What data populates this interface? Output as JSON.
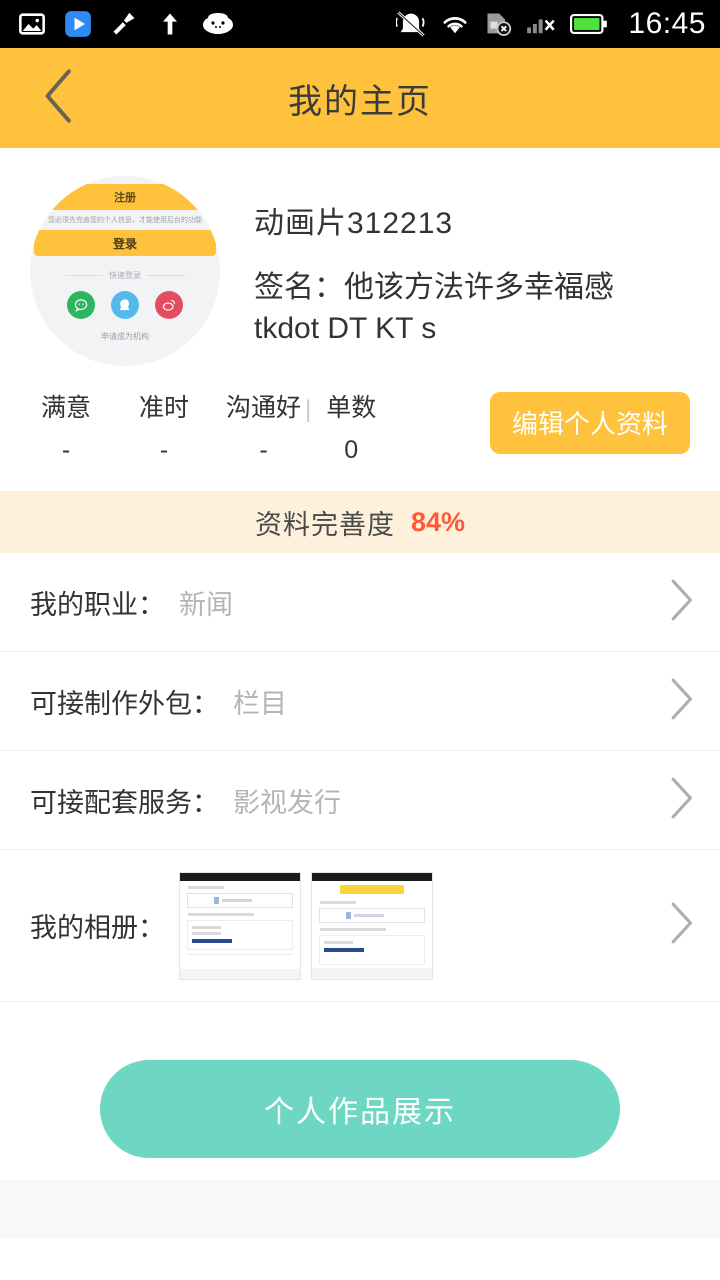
{
  "status_bar": {
    "time": "16:45",
    "left_icons": [
      "image-icon",
      "play-icon",
      "broom-icon",
      "upload-arrow-icon",
      "android-robot-icon"
    ],
    "right_icons": [
      "mute-vibrate-icon",
      "wifi-icon",
      "sim-card-off-icon",
      "signal-off-icon",
      "battery-icon"
    ]
  },
  "header": {
    "title": "我的主页",
    "back_icon": "chevron-left-icon",
    "bg_color": "#FFC23C"
  },
  "profile": {
    "avatar_content": {
      "register_label": "注册",
      "hint": "您必须先完善您的个人信息，才能使用后台的功能",
      "login_label": "登录",
      "quick_login_label": "快速登录",
      "socials": [
        "wechat-icon",
        "qq-icon",
        "weibo-icon"
      ],
      "apply_label": "申请成为机构"
    },
    "name": "动画片312213",
    "signature": "签名：他该方法许多幸福感tkdot DT KT s"
  },
  "stats": {
    "items": [
      {
        "label": "满意",
        "value": "-"
      },
      {
        "label": "准时",
        "value": "-"
      },
      {
        "label": "沟通好",
        "value": "-"
      },
      {
        "label": "单数",
        "value": "0"
      }
    ],
    "separator": "|",
    "edit_button": "编辑个人资料"
  },
  "completeness": {
    "label": "资料完善度",
    "percent": "84%",
    "percent_color": "#FF5A35",
    "bg_color": "#FEF1DB"
  },
  "list": {
    "rows": [
      {
        "label": "我的职业：",
        "value": "新闻"
      },
      {
        "label": "可接制作外包：",
        "value": "栏目"
      },
      {
        "label": "可接配套服务：",
        "value": "影视发行"
      }
    ],
    "album": {
      "label": "我的相册：",
      "thumb_count": 2
    }
  },
  "cta": {
    "label": "个人作品展示",
    "color": "#6ED7C3"
  }
}
